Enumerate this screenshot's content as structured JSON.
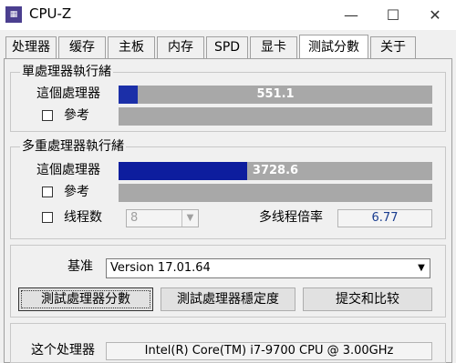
{
  "window": {
    "title": "CPU-Z",
    "icon": "cpu-z-icon",
    "min_label": "—",
    "max_label": "☐",
    "close_label": "✕"
  },
  "tabs": [
    "处理器",
    "缓存",
    "主板",
    "内存",
    "SPD",
    "显卡",
    "测試分數",
    "关于"
  ],
  "active_tab": "测試分數",
  "single": {
    "title": "單處理器執行緒",
    "this_label": "這個處理器",
    "this_value": "551.1",
    "this_fraction": 0.06,
    "ref_label": "參考"
  },
  "multi": {
    "title": "多重處理器執行緒",
    "this_label": "這個處理器",
    "this_value": "3728.6",
    "this_fraction": 0.41,
    "ref_label": "參考",
    "threads_label": "线程数",
    "threads_value": "8",
    "ratio_label": "多线程倍率",
    "ratio_value": "6.77"
  },
  "bench": {
    "label": "基准",
    "version": "Version 17.01.64",
    "btn_bench": "測試處理器分數",
    "btn_stress": "測試處理器穩定度",
    "btn_submit": "提交和比较"
  },
  "footer": {
    "label": "这个处理器",
    "value": "Intel(R) Core(TM) i7-9700 CPU @ 3.00GHz"
  },
  "colors": {
    "bar_single": "#1b2fa8",
    "bar_multi": "#0d1d9e",
    "bar_bg": "#a8a8a8"
  }
}
